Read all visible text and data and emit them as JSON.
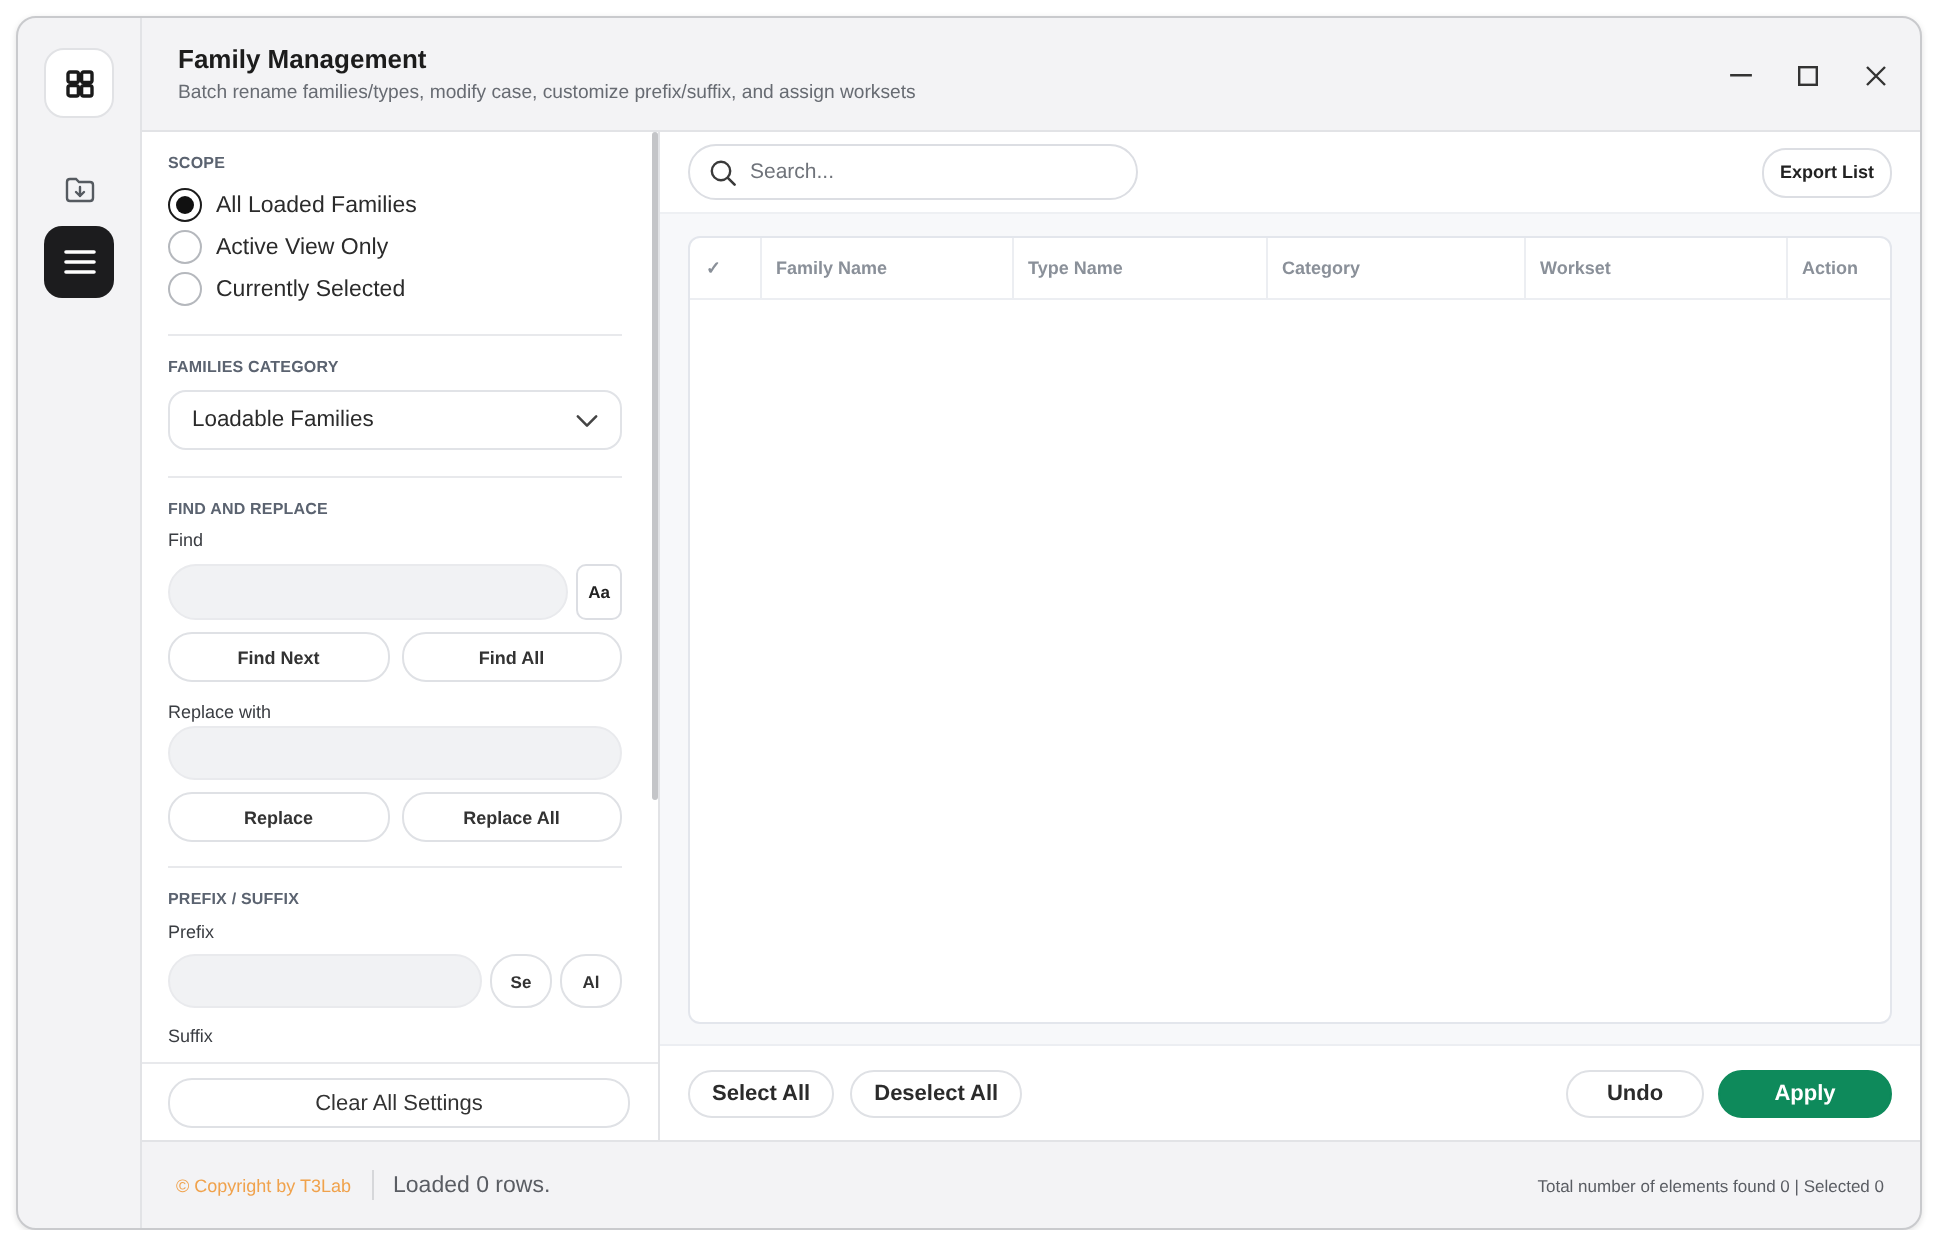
{
  "window": {
    "title": "Family Management",
    "subtitle": "Batch rename families/types, modify case, customize prefix/suffix, and assign worksets"
  },
  "rail": [
    {
      "kind": "import",
      "selected": false
    },
    {
      "kind": "menu",
      "selected": true
    }
  ],
  "scope": {
    "heading": "SCOPE",
    "options": [
      {
        "label": "All Loaded Families",
        "selected": true
      },
      {
        "label": "Active View Only",
        "selected": false
      },
      {
        "label": "Currently Selected",
        "selected": false
      }
    ]
  },
  "category": {
    "heading": "FAMILIES CATEGORY",
    "value": "Loadable Families"
  },
  "find_replace": {
    "heading": "FIND AND REPLACE",
    "find_label": "Find",
    "case_button": "Aa",
    "find_buttons": [
      "Find Next",
      "Find All"
    ],
    "replace_label": "Replace with",
    "replace_buttons": [
      "Replace",
      "Replace All"
    ]
  },
  "prefix_suffix": {
    "heading": "PREFIX / SUFFIX",
    "prefix_label": "Prefix",
    "prefix_buttons": [
      "Se",
      "Al"
    ],
    "suffix_label": "Suffix"
  },
  "clear_button": "Clear All Settings",
  "search": {
    "placeholder": "Search..."
  },
  "export_button": "Export List",
  "table": {
    "columns": [
      "✓",
      "Family Name",
      "Type Name",
      "Category",
      "Workset",
      "Action"
    ]
  },
  "actions": {
    "left": [
      "Select All",
      "Deselect All"
    ],
    "right": [
      {
        "label": "Undo",
        "kind": "secondary"
      },
      {
        "label": "Apply",
        "kind": "primary"
      }
    ]
  },
  "status_bar": {
    "copyright": "© Copyright by T3Lab",
    "loaded": "Loaded 0 rows.",
    "summary": "Total number of elements found 0 | Selected 0"
  }
}
